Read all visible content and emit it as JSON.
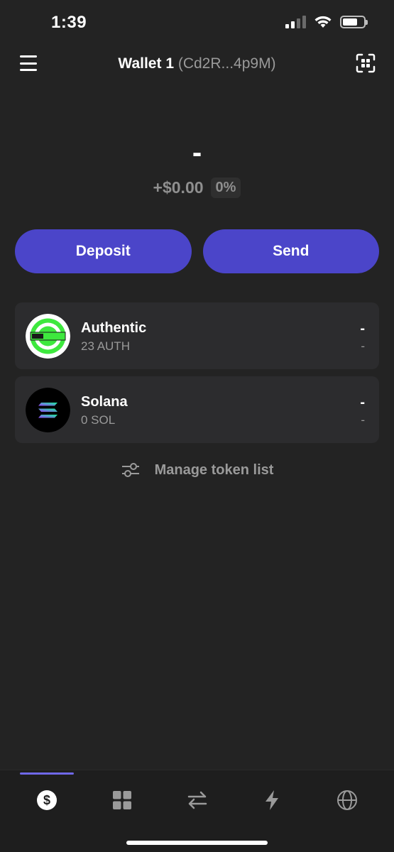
{
  "status_bar": {
    "time": "1:39"
  },
  "header": {
    "wallet_name": "Wallet 1",
    "wallet_address": "(Cd2R...4p9M)"
  },
  "balance": {
    "value": "-",
    "change_amount": "+$0.00",
    "change_percent": "0%"
  },
  "actions": {
    "deposit_label": "Deposit",
    "send_label": "Send"
  },
  "tokens": [
    {
      "name": "Authentic",
      "amount": "23 AUTH",
      "value": "-",
      "change": "-",
      "icon": "authentic-logo"
    },
    {
      "name": "Solana",
      "amount": "0 SOL",
      "value": "-",
      "change": "-",
      "icon": "solana-logo"
    }
  ],
  "manage": {
    "label": "Manage token list",
    "icon": "sliders-icon"
  },
  "tab_bar": {
    "tabs": [
      {
        "icon": "dollar-icon",
        "active": true
      },
      {
        "icon": "grid-icon",
        "active": false
      },
      {
        "icon": "swap-icon",
        "active": false
      },
      {
        "icon": "lightning-icon",
        "active": false
      },
      {
        "icon": "globe-icon",
        "active": false
      }
    ]
  },
  "colors": {
    "background": "#232323",
    "accent": "#4b45c9",
    "card": "#2c2c2e",
    "muted_text": "#9a9a9a",
    "tab_indicator": "#6f68e8"
  }
}
